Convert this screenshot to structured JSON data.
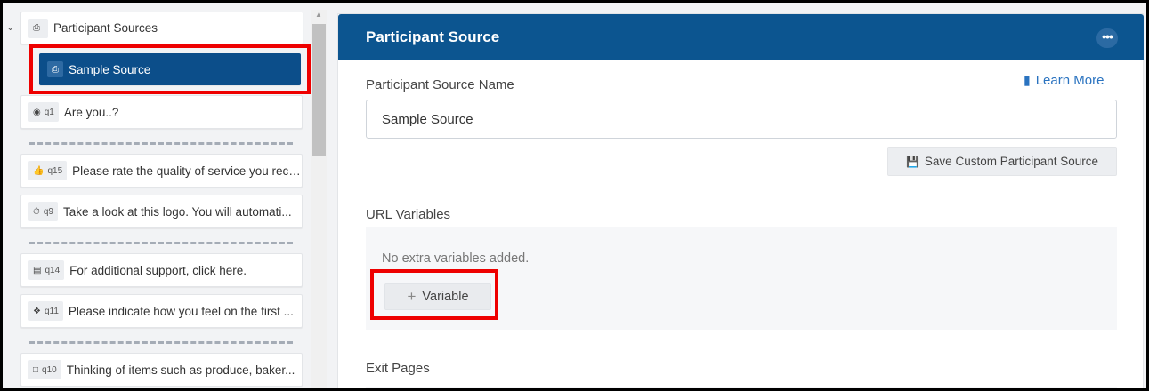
{
  "left_panel": {
    "group": {
      "label": "Participant Sources",
      "icon": "participant-source-icon"
    },
    "selected_item": {
      "label": "Sample Source",
      "icon": "participant-source-icon"
    },
    "questions": [
      {
        "id": "q1",
        "icon": "radio-icon",
        "text": "Are you..?"
      },
      {
        "id": "q15",
        "icon": "thumbs-up-icon",
        "text": "Please rate the quality of service you rece..."
      },
      {
        "id": "q9",
        "icon": "timer-icon",
        "text": "Take a look at this logo. You will automati..."
      },
      {
        "id": "q14",
        "icon": "text-block-icon",
        "text": "For additional support, click here."
      },
      {
        "id": "q11",
        "icon": "grid-icon",
        "text": "Please indicate how you feel on the first ..."
      },
      {
        "id": "q10",
        "icon": "comment-icon",
        "text": "Thinking of items such as produce, baker..."
      }
    ]
  },
  "right_panel": {
    "title": "Participant Source",
    "more_label": "•••",
    "name_label": "Participant Source Name",
    "learn_more": "Learn More",
    "name_value": "Sample Source",
    "save_label": "Save Custom Participant Source",
    "url_variables_label": "URL Variables",
    "no_variables_text": "No extra variables added.",
    "add_variable_label": "Variable",
    "exit_pages_label": "Exit Pages"
  },
  "colors": {
    "header_blue": "#0c5590",
    "selected_blue": "#0c4e8a",
    "link_blue": "#2a73c0",
    "highlight_red": "#e00000"
  }
}
